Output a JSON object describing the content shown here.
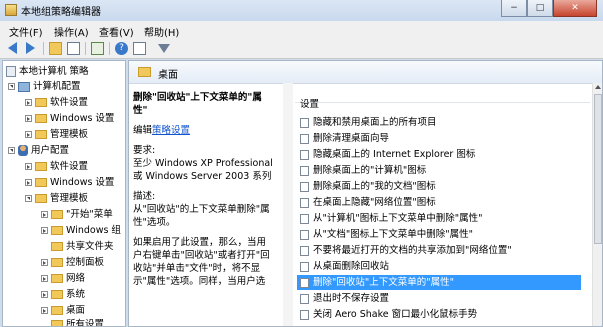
{
  "window": {
    "title": "本地组策略编辑器",
    "minimize": "−",
    "maximize": "□",
    "close": "✕"
  },
  "menu": [
    "文件(F)",
    "操作(A)",
    "查看(V)",
    "帮助(H)"
  ],
  "toolbar": {
    "icons": [
      "back-icon",
      "forward-icon",
      "up-folder-icon",
      "show-hide-tree-icon",
      "export-list-icon",
      "help-icon",
      "properties-icon",
      "filter-icon"
    ]
  },
  "tree": {
    "root": "本地计算机 策略",
    "computer": "计算机配置",
    "c_soft": "软件设置",
    "c_win": "Windows 设置",
    "c_admin": "管理模板",
    "user": "用户配置",
    "u_soft": "软件设置",
    "u_win": "Windows 设置",
    "u_admin": "管理模板",
    "start": "\"开始\"菜单",
    "wincomp": "Windows 组",
    "share": "共享文件夹",
    "control": "控制面板",
    "network": "网络",
    "system": "系统",
    "desktop": "桌面",
    "allsettings": "所有设置"
  },
  "right": {
    "header": "桌面",
    "desc_title": "删除\"回收站\"上下文菜单的\"属性\"",
    "edit_prefix": "编辑",
    "edit_link": "策略设置",
    "req_label": "要求:",
    "req_text": "至少 Windows XP Professional 或 Windows Server 2003 系列",
    "desc_label": "描述:",
    "desc_text": "从\"回收站\"的上下文菜单删除\"属性\"选项。",
    "more_text": "如果启用了此设置，那么，当用户右键单击\"回收站\"或者打开\"回收站\"并单击\"文件\"时，将不显示\"属性\"选项。同样，当用户选",
    "list_header": "设置",
    "items": [
      "隐藏和禁用桌面上的所有项目",
      "删除清理桌面向导",
      "隐藏桌面上的 Internet Explorer 图标",
      "删除桌面上的\"计算机\"图标",
      "删除桌面上的\"我的文档\"图标",
      "在桌面上隐藏\"网络位置\"图标",
      "从\"计算机\"图标上下文菜单中删除\"属性\"",
      "从\"文档\"图标上下文菜单中删除\"属性\"",
      "不要将最近打开的文档的共享添加到\"网络位置\"",
      "从桌面删除回收站",
      "删除\"回收站\"上下文菜单的\"属性\"",
      "退出时不保存设置",
      "关闭 Aero Shake 窗口最小化鼠标手势"
    ],
    "selected_index": 10
  }
}
